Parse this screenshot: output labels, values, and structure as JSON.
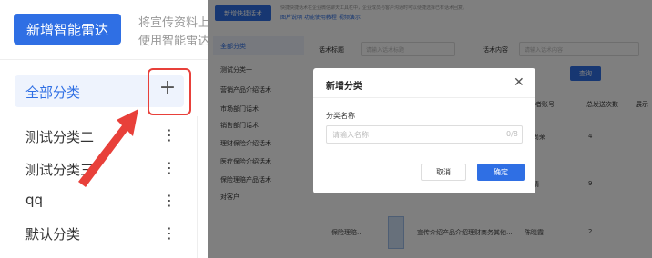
{
  "left": {
    "new_button": "新增智能雷达",
    "hint_line1": "将宣传资料上传",
    "hint_line2": "使用智能雷达系",
    "selected_category": "全部分类",
    "add_symbol": "+",
    "categories": [
      "测试分类二",
      "测试分类三",
      "qq",
      "默认分类"
    ],
    "more_symbol": "⋮",
    "accent": "#2f6fe4",
    "highlight": "#e8403a"
  },
  "right": {
    "toolbar_button": "新增快捷话术",
    "toolbar_desc": "快捷快捷话术在企业微信聊天工具栏中，企业成员与客户沟通时可以便捷选择已有话术回复。",
    "toolbar_links": "图片说明   功能使用教程   视频演示",
    "sidebar_all": "全部分类",
    "sidebar_items": [
      "测试分类一",
      "营销产品介绍话术",
      "市场部门话术",
      "销售部门话术",
      "理财保险介绍话术",
      "医疗保险介绍话术",
      "保险理赔产品话术",
      "对客户"
    ],
    "filter_title_label": "话术标题",
    "filter_title_ph": "请输入话术标题",
    "filter_content_label": "话术内容",
    "filter_content_ph": "请输入话术内容",
    "query_button": "查询",
    "table_headers": [
      "创建者账号",
      "总发送次数",
      "展示"
    ],
    "rows": [
      {
        "creator": "林尚荣",
        "count": "4"
      },
      {
        "creator": "冯靖",
        "count": "9"
      },
      {
        "name": "保险理赔...",
        "desc": "宣传介绍产品介绍理财商务其他...",
        "creator": "陈晓霞",
        "count": "2"
      }
    ],
    "dialog": {
      "title": "新增分类",
      "close_symbol": "✕",
      "field_label": "分类名称",
      "field_placeholder": "请输入名称",
      "field_counter": "0/8",
      "cancel": "取消",
      "confirm": "确定"
    }
  }
}
